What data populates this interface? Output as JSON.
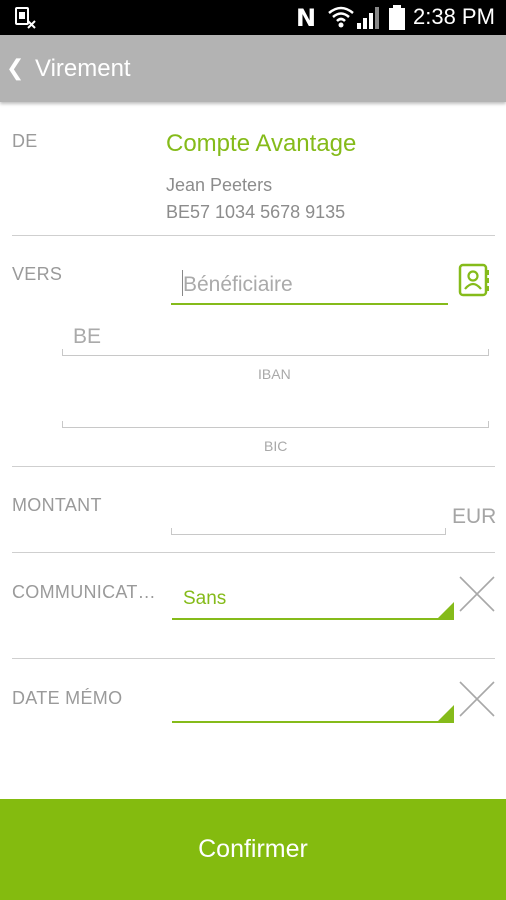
{
  "status_bar": {
    "time": "2:38 PM",
    "nfc_glyph": "N",
    "icons": [
      "sim-card-off-icon",
      "nfc-icon",
      "wifi-icon",
      "signal-icon",
      "battery-icon"
    ]
  },
  "app_bar": {
    "back_glyph": "❮",
    "title": "Virement"
  },
  "from": {
    "label": "DE",
    "account_name": "Compte Avantage",
    "holder": "Jean Peeters",
    "iban": "BE57 1034 5678 9135"
  },
  "to": {
    "label": "VERS",
    "beneficiary_placeholder": "Bénéficiaire",
    "beneficiary_value": "",
    "iban_prefix": "BE",
    "iban_value": "",
    "iban_label": "IBAN",
    "bic_value": "",
    "bic_label": "BIC"
  },
  "amount": {
    "label": "MONTANT",
    "value": "",
    "currency": "EUR"
  },
  "communication": {
    "label": "COMMUNICAT…",
    "value": "Sans"
  },
  "memo_date": {
    "label": "DATE MÉMO",
    "value": ""
  },
  "confirm_label": "Confirmer",
  "colors": {
    "accent": "#85bb1a",
    "appbar": "#b3b3b3",
    "confirm": "#84bb0f"
  }
}
